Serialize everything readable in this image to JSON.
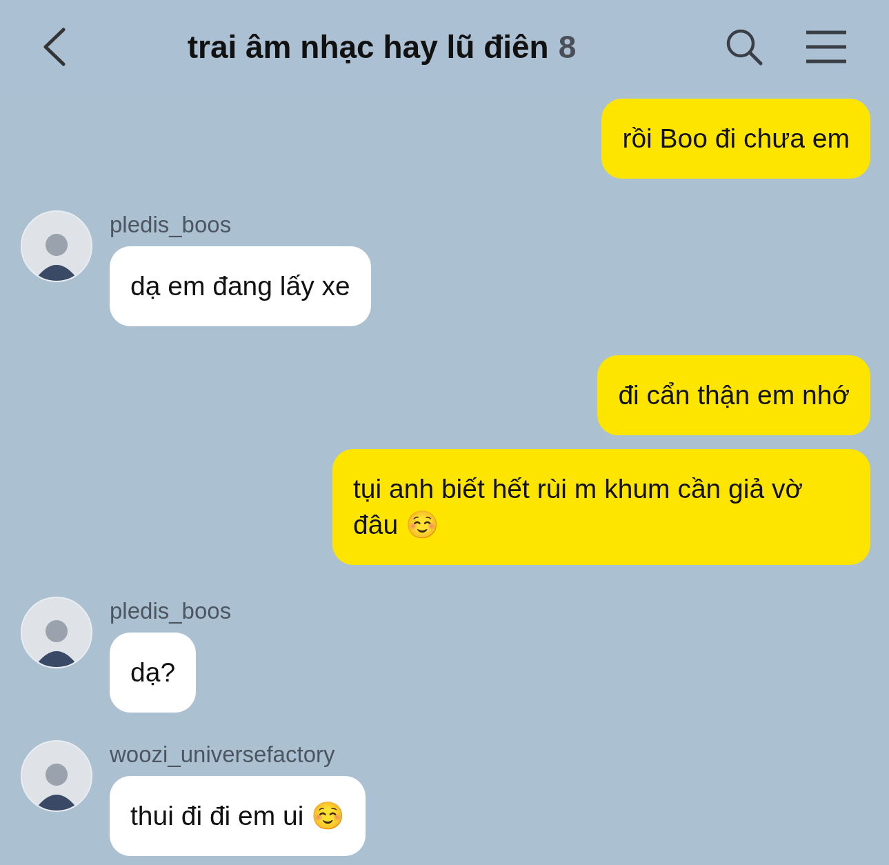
{
  "header": {
    "title": "trai âm nhạc hay lũ điên",
    "member_count": "8"
  },
  "messages": [
    {
      "kind": "outgoing",
      "text": "rồi Boo đi chưa em"
    },
    {
      "kind": "incoming",
      "sender": "pledis_boos",
      "text": "dạ em đang lấy xe"
    },
    {
      "kind": "outgoing",
      "text": "đi cẩn thận em nhớ"
    },
    {
      "kind": "outgoing",
      "text": "tụi anh biết hết rùi m khum cần giả vờ đâu ☺️"
    },
    {
      "kind": "incoming",
      "sender": "pledis_boos",
      "text": "dạ?"
    },
    {
      "kind": "incoming",
      "sender": "woozi_universefactory",
      "text": "thui đi đi em ui ☺️"
    }
  ]
}
